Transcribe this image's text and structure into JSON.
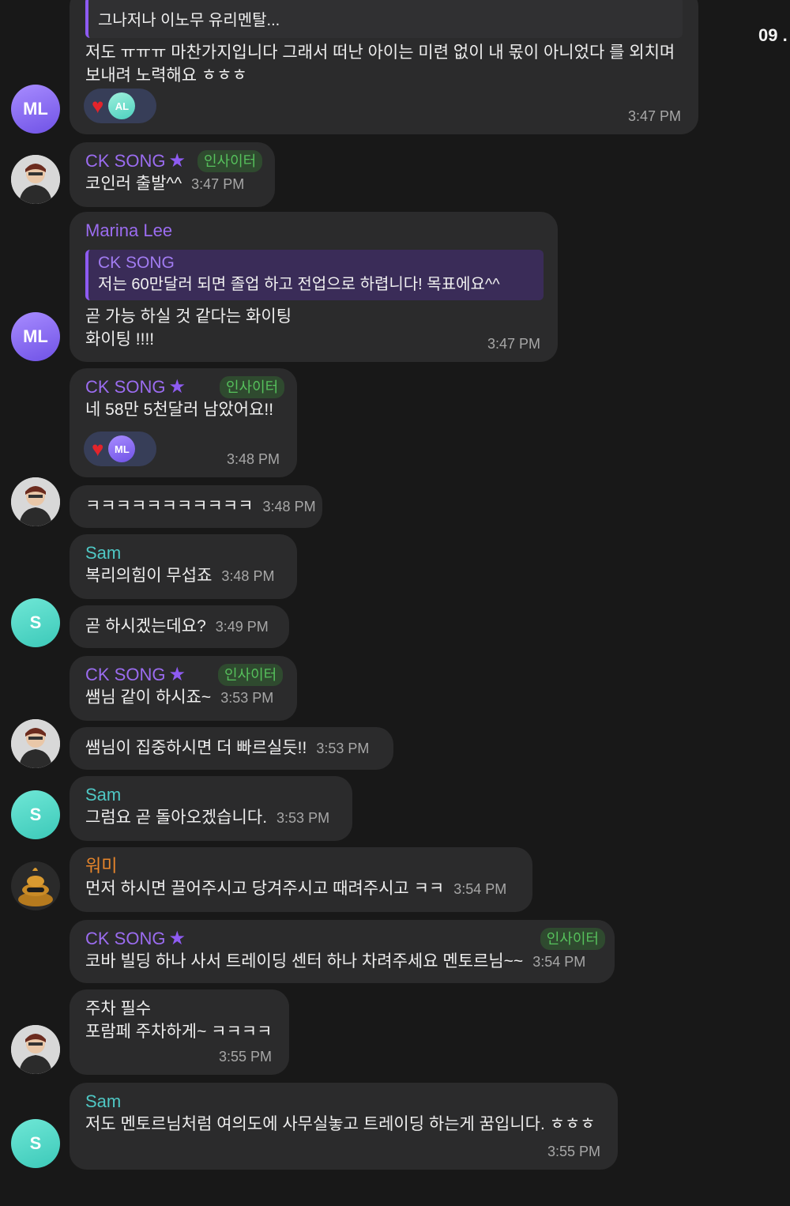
{
  "header": {
    "date_fragment": "09 ."
  },
  "messages": {
    "m1": {
      "quote": "그나저나 이노무 유리멘탈...",
      "line1": "저도 ㅠㅠㅠ 마찬가지입니다 그래서 떠난 아이는 미련 없이 내 몫이 아니었다 를 외치며",
      "line2": "보내려 노력해요 ㅎㅎㅎ",
      "reaction": "AL",
      "time": "3:47 PM"
    },
    "m2": {
      "name": "CK SONG",
      "badge": "인사이터",
      "text": "코인러 출발^^",
      "time": "3:47 PM"
    },
    "m3": {
      "name": "Marina Lee",
      "quote_name": "CK SONG",
      "quote_text": "저는 60만달러 되면 졸업 하고 전업으로 하렵니다! 목표에요^^",
      "line1": "곧 가능 하실 것 같다는 화이팅",
      "line2": "화이팅 !!!!",
      "time": "3:47 PM"
    },
    "m4": {
      "name": "CK SONG",
      "badge": "인사이터",
      "text": "네 58만 5천달러 남았어요!!",
      "reaction": "ML",
      "time": "3:48 PM"
    },
    "m5": {
      "text": "ㅋㅋㅋㅋㅋㅋㅋㅋㅋㅋㅋ",
      "time": "3:48 PM"
    },
    "m6": {
      "name": "Sam",
      "text": "복리의힘이 무섭죠",
      "time": "3:48 PM"
    },
    "m7": {
      "text": "곧 하시겠는데요?",
      "time": "3:49 PM"
    },
    "m8": {
      "name": "CK SONG",
      "badge": "인사이터",
      "text": "쌤님 같이 하시죠~",
      "time": "3:53 PM"
    },
    "m9": {
      "text": "쌤님이 집중하시면 더 빠르실듯!!",
      "time": "3:53 PM"
    },
    "m10": {
      "name": "Sam",
      "text": "그럼요 곧 돌아오겠습니다.",
      "time": "3:53 PM"
    },
    "m11": {
      "name": "워미",
      "text": "먼저 하시면 끌어주시고 당겨주시고 때려주시고 ㅋㅋ",
      "time": "3:54 PM"
    },
    "m12": {
      "name": "CK SONG",
      "badge": "인사이터",
      "text": "코바 빌딩 하나 사서 트레이딩 센터 하나 차려주세요 멘토르님~~",
      "time": "3:54 PM"
    },
    "m13": {
      "line1": "주차 필수",
      "line2": "포람페 주차하게~ ㅋㅋㅋㅋ",
      "time": "3:55 PM"
    },
    "m14": {
      "name": "Sam",
      "text": "저도 멘토르님처럼 여의도에 사무실놓고 트레이딩 하는게 꿈입니다. ㅎㅎㅎ",
      "time": "3:55 PM"
    }
  },
  "avatars": {
    "ml": "ML",
    "s": "S"
  },
  "colors": {
    "background": "#181818",
    "bubble": "#2b2b2c",
    "name_purple": "#9b6cf0",
    "name_teal": "#4fc7c4",
    "name_orange": "#e8862b",
    "badge_green": "#56c15c",
    "heart": "#e3242b"
  },
  "icons": {
    "star": "star-icon",
    "heart": "heart-icon"
  }
}
